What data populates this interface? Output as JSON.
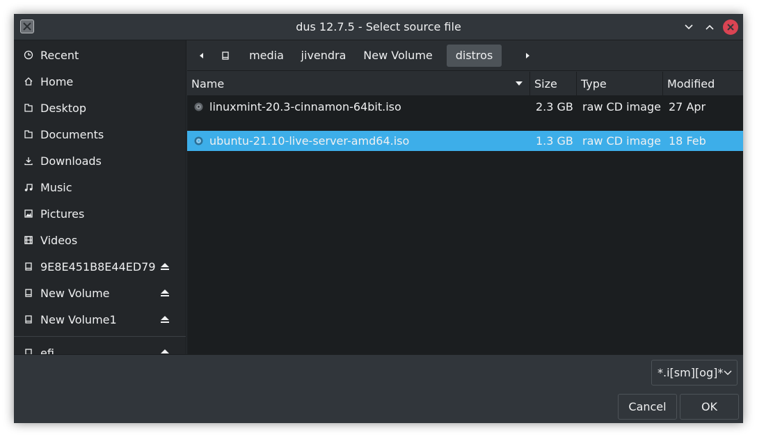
{
  "window": {
    "title": "dus 12.7.5 - Select source file"
  },
  "sidebar": {
    "items": [
      {
        "label": "Recent",
        "icon": "clock-icon"
      },
      {
        "label": "Home",
        "icon": "home-icon"
      },
      {
        "label": "Desktop",
        "icon": "folder-icon"
      },
      {
        "label": "Documents",
        "icon": "folder-icon"
      },
      {
        "label": "Downloads",
        "icon": "download-icon"
      },
      {
        "label": "Music",
        "icon": "music-icon"
      },
      {
        "label": "Pictures",
        "icon": "image-icon"
      },
      {
        "label": "Videos",
        "icon": "film-icon"
      },
      {
        "label": "9E8E451B8E44ED79",
        "icon": "drive-icon",
        "eject": true
      },
      {
        "label": "New Volume",
        "icon": "drive-icon",
        "eject": true
      },
      {
        "label": "New Volume1",
        "icon": "drive-icon",
        "eject": true
      },
      {
        "label": "efi",
        "icon": "drive-icon",
        "eject": true
      }
    ]
  },
  "pathbar": {
    "segments": [
      "media",
      "jivendra",
      "New Volume",
      "distros"
    ],
    "active": "distros"
  },
  "filelist": {
    "columns": [
      "Name",
      "Size",
      "Type",
      "Modified"
    ],
    "rows": [
      {
        "name": "linuxmint-20.3-cinnamon-64bit.iso",
        "size": "2.3 GB",
        "type": "raw CD image",
        "modified": "27 Apr",
        "selected": false
      },
      {
        "name": "ubuntu-21.10-live-server-amd64.iso",
        "size": "1.3 GB",
        "type": "raw CD image",
        "modified": "18 Feb",
        "selected": true
      }
    ]
  },
  "filter": {
    "value": "*.i[sm][og]*"
  },
  "buttons": {
    "cancel": "Cancel",
    "ok": "OK"
  },
  "colors": {
    "accent": "#3daee9",
    "close": "#da4453",
    "background": "#2a2e32"
  }
}
